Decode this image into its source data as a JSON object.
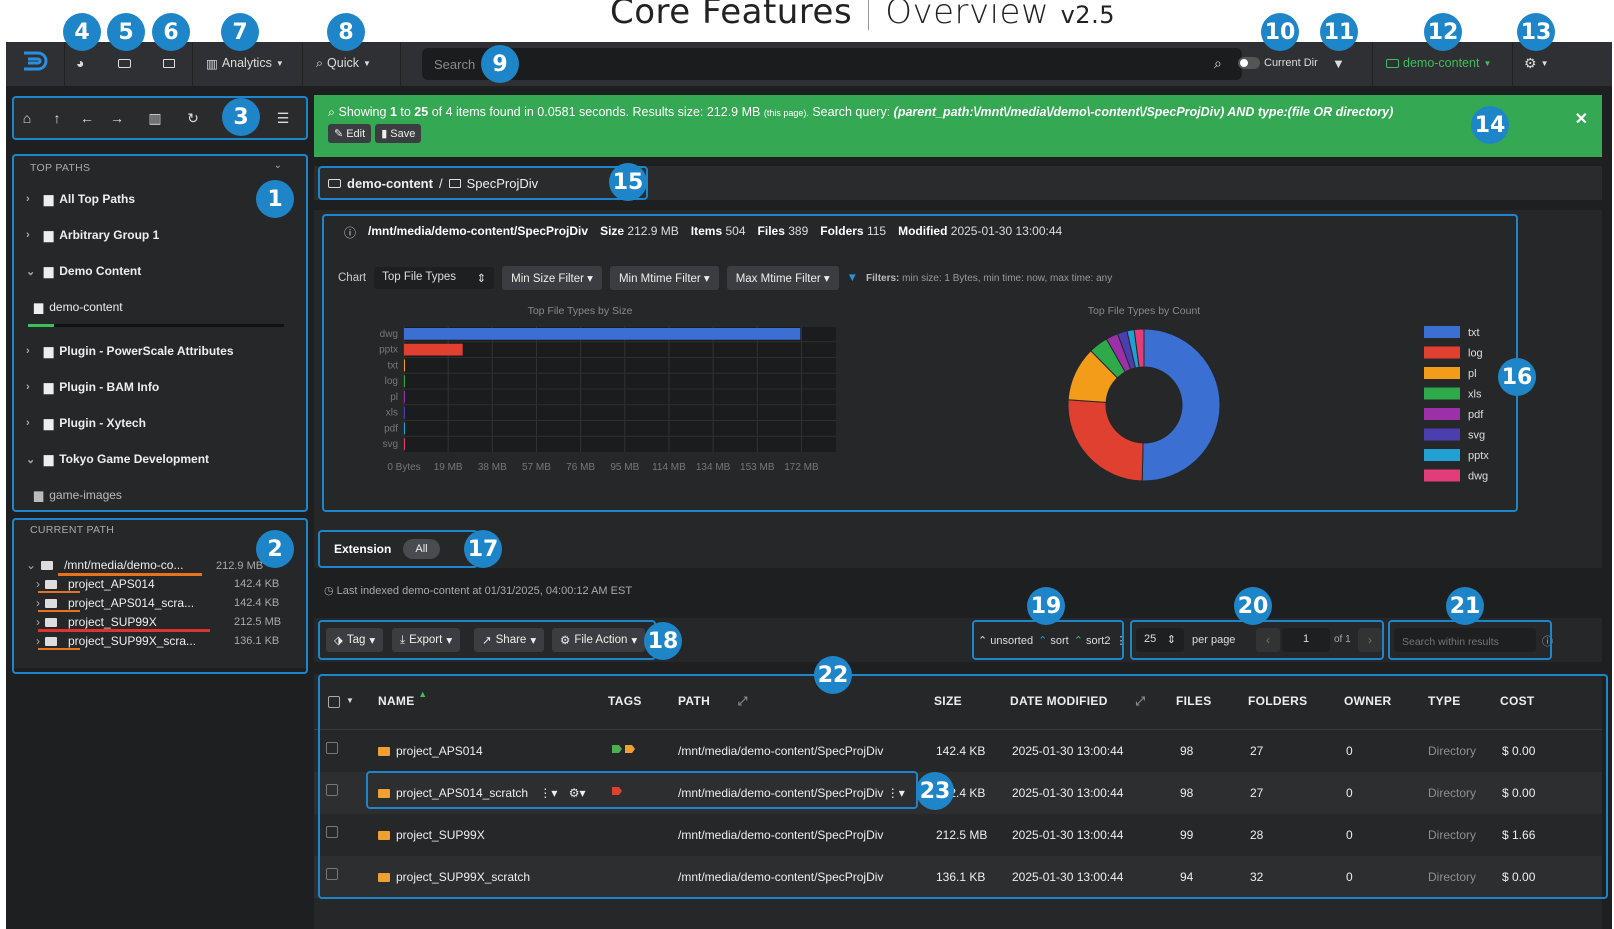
{
  "header": {
    "core": "Core Features",
    "overview": "Overview",
    "version": "v2.5"
  },
  "navbar": {
    "analytics": "Analytics",
    "quick": "Quick",
    "search_placeholder": "Search",
    "current_dir": "Current Dir",
    "index_selector": "demo-content"
  },
  "badges": [
    "1",
    "2",
    "3",
    "4",
    "5",
    "6",
    "7",
    "8",
    "9",
    "10",
    "11",
    "12",
    "13",
    "14",
    "15",
    "16",
    "17",
    "18",
    "19",
    "20",
    "21",
    "22",
    "23"
  ],
  "top_paths": {
    "title": "TOP PATHS",
    "items": [
      "All Top Paths",
      "Arbitrary Group 1",
      "Demo Content",
      "demo-content",
      "Plugin - PowerScale Attributes",
      "Plugin - BAM Info",
      "Plugin - Xytech",
      "Tokyo Game Development",
      "game-images"
    ]
  },
  "current_path": {
    "title": "CURRENT PATH",
    "root": {
      "name": "/mnt/media/demo-co...",
      "size": "212.9 MB"
    },
    "items": [
      {
        "name": "project_APS014",
        "size": "142.4 KB"
      },
      {
        "name": "project_APS014_scra...",
        "size": "142.4 KB"
      },
      {
        "name": "project_SUP99X",
        "size": "212.5 MB"
      },
      {
        "name": "project_SUP99X_scra...",
        "size": "136.1 KB"
      }
    ]
  },
  "alert": {
    "showing": "Showing",
    "from": "1",
    "to_word": "to",
    "to": "25",
    "rest": "of 4 items found in 0.0581 seconds. Results size: 212.9 MB",
    "this_page": "(this page).",
    "query_label": "Search query:",
    "query": "(parent_path:\\/mnt\\/media\\/demo\\-content\\/SpecProjDiv) AND type:(file OR directory)",
    "edit": "Edit",
    "save": "Save"
  },
  "breadcrumb": {
    "index": "demo-content",
    "sep": "/",
    "folder": "SpecProjDiv"
  },
  "info": {
    "path": "/mnt/media/demo-content/SpecProjDiv",
    "size_label": "Size",
    "size": "212.9 MB",
    "items_label": "Items",
    "items": "504",
    "files_label": "Files",
    "files": "389",
    "folders_label": "Folders",
    "folders": "115",
    "modified_label": "Modified",
    "modified": "2025-01-30 13:00:44"
  },
  "chart_controls": {
    "chart_label": "Chart",
    "chart_select": "Top File Types",
    "min_size": "Min Size Filter",
    "min_mtime": "Min Mtime Filter",
    "max_mtime": "Max Mtime Filter",
    "filters_label": "Filters:",
    "filters_text": "min size: 1 Bytes, min time: now, max time: any"
  },
  "chart_data": [
    {
      "type": "bar",
      "title": "Top File Types by Size",
      "orientation": "horizontal",
      "categories": [
        "dwg",
        "pptx",
        "txt",
        "log",
        "pl",
        "xls",
        "pdf",
        "svg"
      ],
      "values_mb": [
        171.5,
        25.4,
        0.3,
        0.2,
        0.1,
        0.05,
        0.03,
        0.01
      ],
      "colors": [
        "#3b6fd1",
        "#e0402f",
        "#f39c1a",
        "#2eaa4a",
        "#9b30a8",
        "#4b3fb0",
        "#21a0d4",
        "#e23d78"
      ],
      "xtick_labels": [
        "0 Bytes",
        "19 MB",
        "38 MB",
        "57 MB",
        "76 MB",
        "95 MB",
        "114 MB",
        "134 MB",
        "153 MB",
        "172 MB"
      ],
      "xlim": [
        0,
        172
      ],
      "grid": true
    },
    {
      "type": "pie",
      "title": "Top File Types by Count",
      "donut": true,
      "labels": [
        "txt",
        "log",
        "pl",
        "xls",
        "pdf",
        "svg",
        "pptx",
        "dwg"
      ],
      "values": [
        196,
        100,
        45,
        16,
        10,
        8,
        6,
        8
      ],
      "colors": [
        "#3b6fd1",
        "#e0402f",
        "#f39c1a",
        "#2eaa4a",
        "#9b30a8",
        "#4b3fb0",
        "#21a0d4",
        "#e23d78"
      ],
      "legend": "right"
    }
  ],
  "extension": {
    "label": "Extension",
    "all": "All"
  },
  "last_indexed": "Last indexed demo-content at 01/31/2025, 04:00:12 AM EST",
  "actions": {
    "tag": "Tag",
    "export": "Export",
    "share": "Share",
    "file_action": "File Action"
  },
  "sort": {
    "s1": "unsorted",
    "s2": "sort",
    "s3": "sort2"
  },
  "pagination": {
    "per_page_value": "25",
    "per_page": "per page",
    "page": "1",
    "of": "of 1"
  },
  "search_results_placeholder": "Search within results",
  "table": {
    "headers": [
      "NAME",
      "TAGS",
      "PATH",
      "SIZE",
      "DATE MODIFIED",
      "FILES",
      "FOLDERS",
      "OWNER",
      "TYPE",
      "COST"
    ],
    "rows": [
      {
        "name": "project_APS014",
        "path": "/mnt/media/demo-content/SpecProjDiv",
        "size": "142.4 KB",
        "modified": "2025-01-30 13:00:44",
        "files": "98",
        "folders": "27",
        "owner": "0",
        "type": "Directory",
        "cost": "$ 0.00"
      },
      {
        "name": "project_APS014_scratch",
        "path": "/mnt/media/demo-content/SpecProjDiv",
        "size": "142.4 KB",
        "modified": "2025-01-30 13:00:44",
        "files": "98",
        "folders": "27",
        "owner": "0",
        "type": "Directory",
        "cost": "$ 0.00"
      },
      {
        "name": "project_SUP99X",
        "path": "/mnt/media/demo-content/SpecProjDiv",
        "size": "212.5 MB",
        "modified": "2025-01-30 13:00:44",
        "files": "99",
        "folders": "28",
        "owner": "0",
        "type": "Directory",
        "cost": "$ 1.66"
      },
      {
        "name": "project_SUP99X_scratch",
        "path": "/mnt/media/demo-content/SpecProjDiv",
        "size": "136.1 KB",
        "modified": "2025-01-30 13:00:44",
        "files": "94",
        "folders": "32",
        "owner": "0",
        "type": "Directory",
        "cost": "$ 0.00"
      }
    ]
  }
}
